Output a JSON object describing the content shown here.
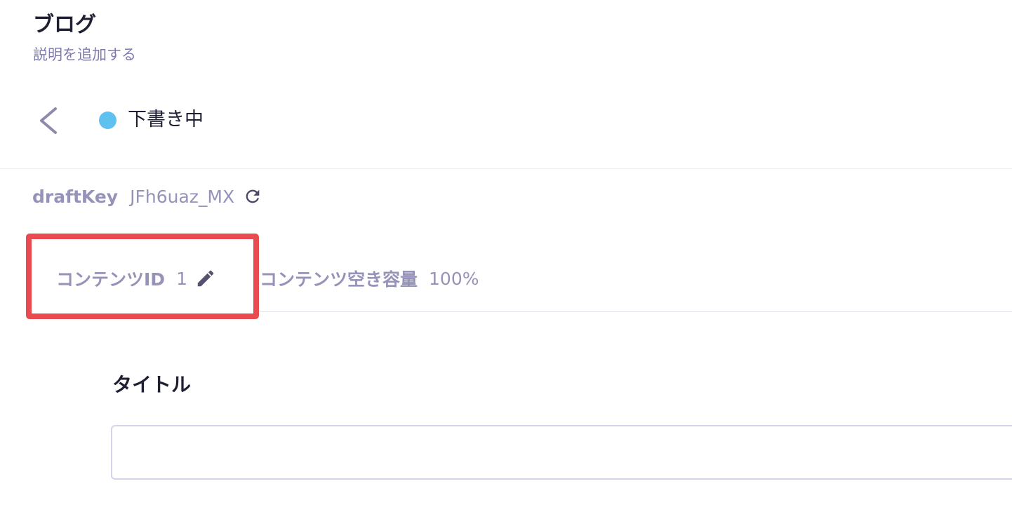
{
  "header": {
    "title": "ブログ",
    "description_link": "説明を追加する"
  },
  "status_bar": {
    "back_icon": "chevron-left-icon",
    "status_text": "下書き中",
    "status_color": "#5ec1f0"
  },
  "draft": {
    "key_label": "draftKey",
    "key_value": "JFh6uaz_MX",
    "refresh_icon": "refresh-icon"
  },
  "content_meta": {
    "id_label": "コンテンツID",
    "id_value": "1",
    "edit_icon": "pencil-icon",
    "capacity_label": "コンテンツ空き容量",
    "capacity_value": "100%",
    "highlight_color": "#e84a4f"
  },
  "form": {
    "title_field": {
      "label": "タイトル",
      "value": ""
    }
  }
}
